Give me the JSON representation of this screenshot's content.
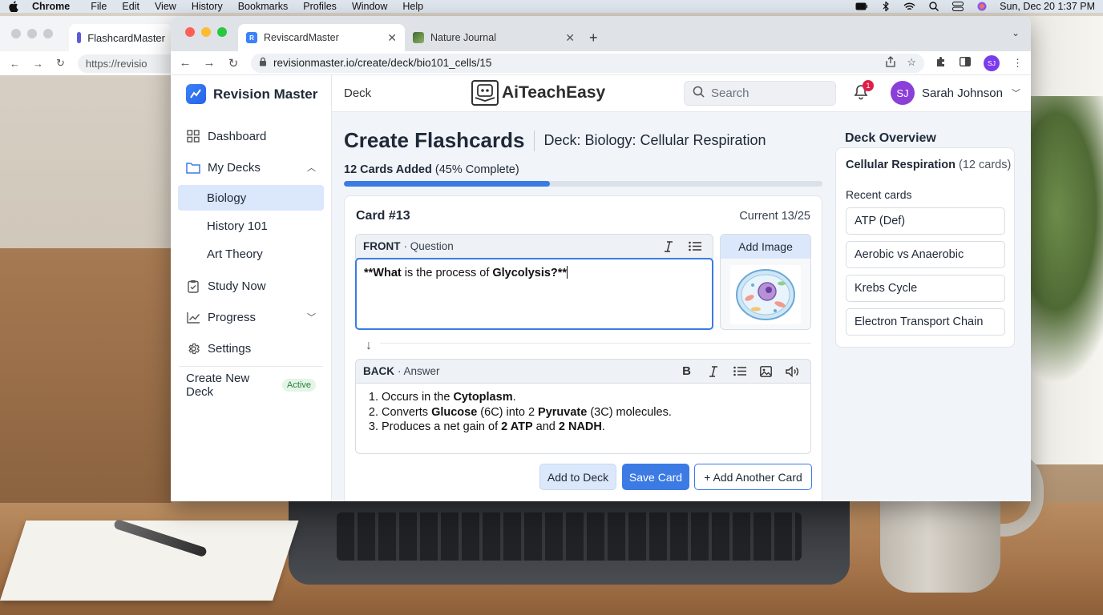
{
  "menubar": {
    "app": "Chrome",
    "items": [
      "File",
      "Edit",
      "View",
      "History",
      "Bookmarks",
      "Profiles",
      "Window",
      "Help"
    ],
    "clock": "Sun, Dec 20  1:37 PM"
  },
  "back_window": {
    "tab_title": "FlashcardMaster",
    "url": "https://revisio"
  },
  "browser": {
    "tabs": [
      {
        "title": "ReviscardMaster",
        "active": true
      },
      {
        "title": "Nature Journal",
        "active": false
      }
    ],
    "new_tab": "+",
    "url": "revisionmaster.io/create/deck/bio101_cells/15",
    "profile_initials": "SJ"
  },
  "sidebar": {
    "brand": "Revision Master",
    "items": [
      {
        "label": "Dashboard",
        "icon": "grid-icon"
      },
      {
        "label": "My Decks",
        "icon": "folder-icon",
        "expanded": true
      },
      {
        "label": "Study Now",
        "icon": "clipboard-icon"
      },
      {
        "label": "Progress",
        "icon": "chart-line-icon"
      },
      {
        "label": "Settings",
        "icon": "gear-icon"
      }
    ],
    "decks": [
      "Biology",
      "History 101",
      "Art Theory"
    ],
    "active_deck": "Biology",
    "create_deck": "Create New Deck",
    "create_badge": "Active"
  },
  "topbar": {
    "section": "Deck",
    "logo_text": "AiTeachEasy",
    "search_placeholder": "Search",
    "notification_count": "1",
    "user_initials": "SJ",
    "user_name": "Sarah Johnson"
  },
  "page": {
    "title": "Create Flashcards",
    "deck": "Deck: Biology: Cellular Respiration",
    "progress_bold": "12 Cards Added",
    "progress_rest": " (45% Complete)",
    "progress_fraction": 0.43
  },
  "card": {
    "number": "Card #13",
    "current": "Current 13/25",
    "front_label": "FRONT",
    "front_sub": " · Question",
    "front_text": {
      "p1": "**What",
      "p2": " is the process of ",
      "p3": "Glycolysis?**"
    },
    "add_image": "Add Image",
    "back_label": "BACK",
    "back_sub": " · Answer",
    "answer": [
      {
        "a": "Occurs in the ",
        "b": "Cytoplasm",
        "c": "."
      },
      {
        "a": "Converts ",
        "b": "Glucose",
        "c": " (6C) into 2 ",
        "d": "Pyruvate",
        "e": " (3C) molecules."
      },
      {
        "a": "Produces a net gain of ",
        "b": "2 ATP",
        "c": " and ",
        "d": "2 NADH",
        "e": "."
      }
    ],
    "buttons": {
      "add_to_deck": "Add to Deck",
      "save": "Save Card",
      "add_another": "+ Add Another Card"
    }
  },
  "overview": {
    "title": "Deck Overview",
    "deck_name": "Cellular Respiration",
    "deck_count": " (12 cards)",
    "recent_label": "Recent cards",
    "recent": [
      "ATP (Def)",
      "Aerobic vs Anaerobic",
      "Krebs Cycle",
      "Electron Transport Chain"
    ]
  },
  "colors": {
    "accent": "#3b7be3",
    "active_bg": "#dbe8fb",
    "badge_green": "#2f7d3b"
  }
}
